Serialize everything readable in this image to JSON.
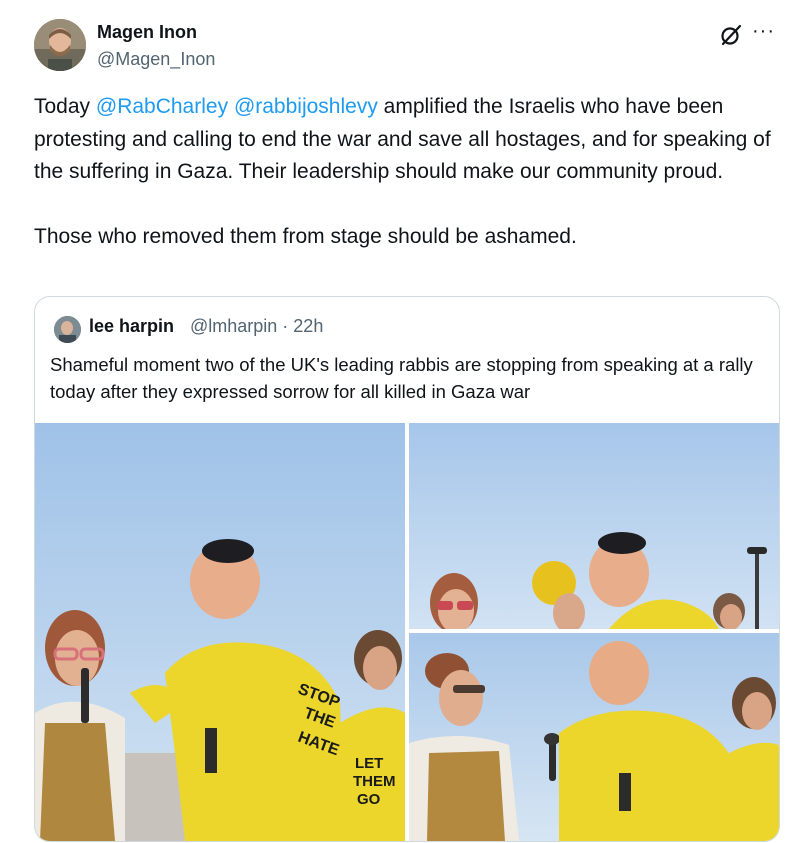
{
  "post": {
    "author_name": "Magen Inon",
    "author_handle": "@Magen_Inon",
    "menu_label": "···",
    "text_p1_before": "Today ",
    "mention_1": "@RabCharley",
    "text_p1_between": " ",
    "mention_2": "@rabbijoshlevy",
    "text_p1_after": " amplified the Israelis who have been protesting and calling to end the war and save all hostages, and for speaking of the suffering in Gaza. Their leadership should make our community proud.",
    "text_p2": "Those who removed them from stage should be ashamed."
  },
  "quoted": {
    "author_name": "lee harpin",
    "meta": "@lmharpin · 22h",
    "text": "Shameful moment two of the UK's leading rabbis are stopping from speaking at a rally today after they expressed sorrow for all killed in Gaza war",
    "shirt_text_1": "STOP THE HATE",
    "shirt_text_2": "LET THEM GO"
  },
  "colors": {
    "link": "#1d9bf0",
    "secondary_text": "#536471",
    "border": "#cfd9de",
    "shirt_yellow": "#ecd62c",
    "sky": "#b8d3ee"
  },
  "icons": {
    "grok": "grok-slash-icon",
    "more": "more-horizontal-icon"
  }
}
